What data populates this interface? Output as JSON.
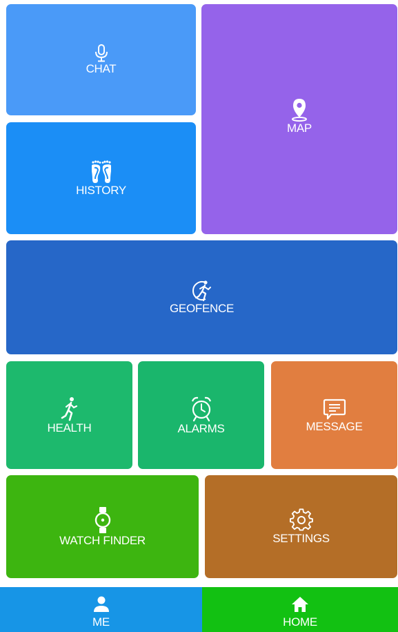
{
  "tiles": {
    "chat": {
      "label": "CHAT",
      "icon": "microphone-icon",
      "color": "#4a9af8"
    },
    "history": {
      "label": "HISTORY",
      "icon": "footprints-icon",
      "color": "#1b8ef6"
    },
    "map": {
      "label": "MAP",
      "icon": "location-pin-icon",
      "color": "#9563ea"
    },
    "geofence": {
      "label": "GEOFENCE",
      "icon": "geofence-runner-icon",
      "color": "#2667c8"
    },
    "health": {
      "label": "HEALTH",
      "icon": "running-person-icon",
      "color": "#1db96d"
    },
    "alarms": {
      "label": "ALARMS",
      "icon": "alarm-clock-icon",
      "color": "#1ab66c"
    },
    "message": {
      "label": "MESSAGE",
      "icon": "message-icon",
      "color": "#e17e40"
    },
    "watch_finder": {
      "label": "WATCH FINDER",
      "icon": "watch-icon",
      "color": "#3db510"
    },
    "settings": {
      "label": "SETTINGS",
      "icon": "gear-icon",
      "color": "#b46e27"
    }
  },
  "bottom_nav": {
    "me": {
      "label": "ME",
      "icon": "person-icon",
      "color": "#1795e6"
    },
    "home": {
      "label": "HOME",
      "icon": "home-icon",
      "color": "#12c112",
      "active": true
    }
  }
}
